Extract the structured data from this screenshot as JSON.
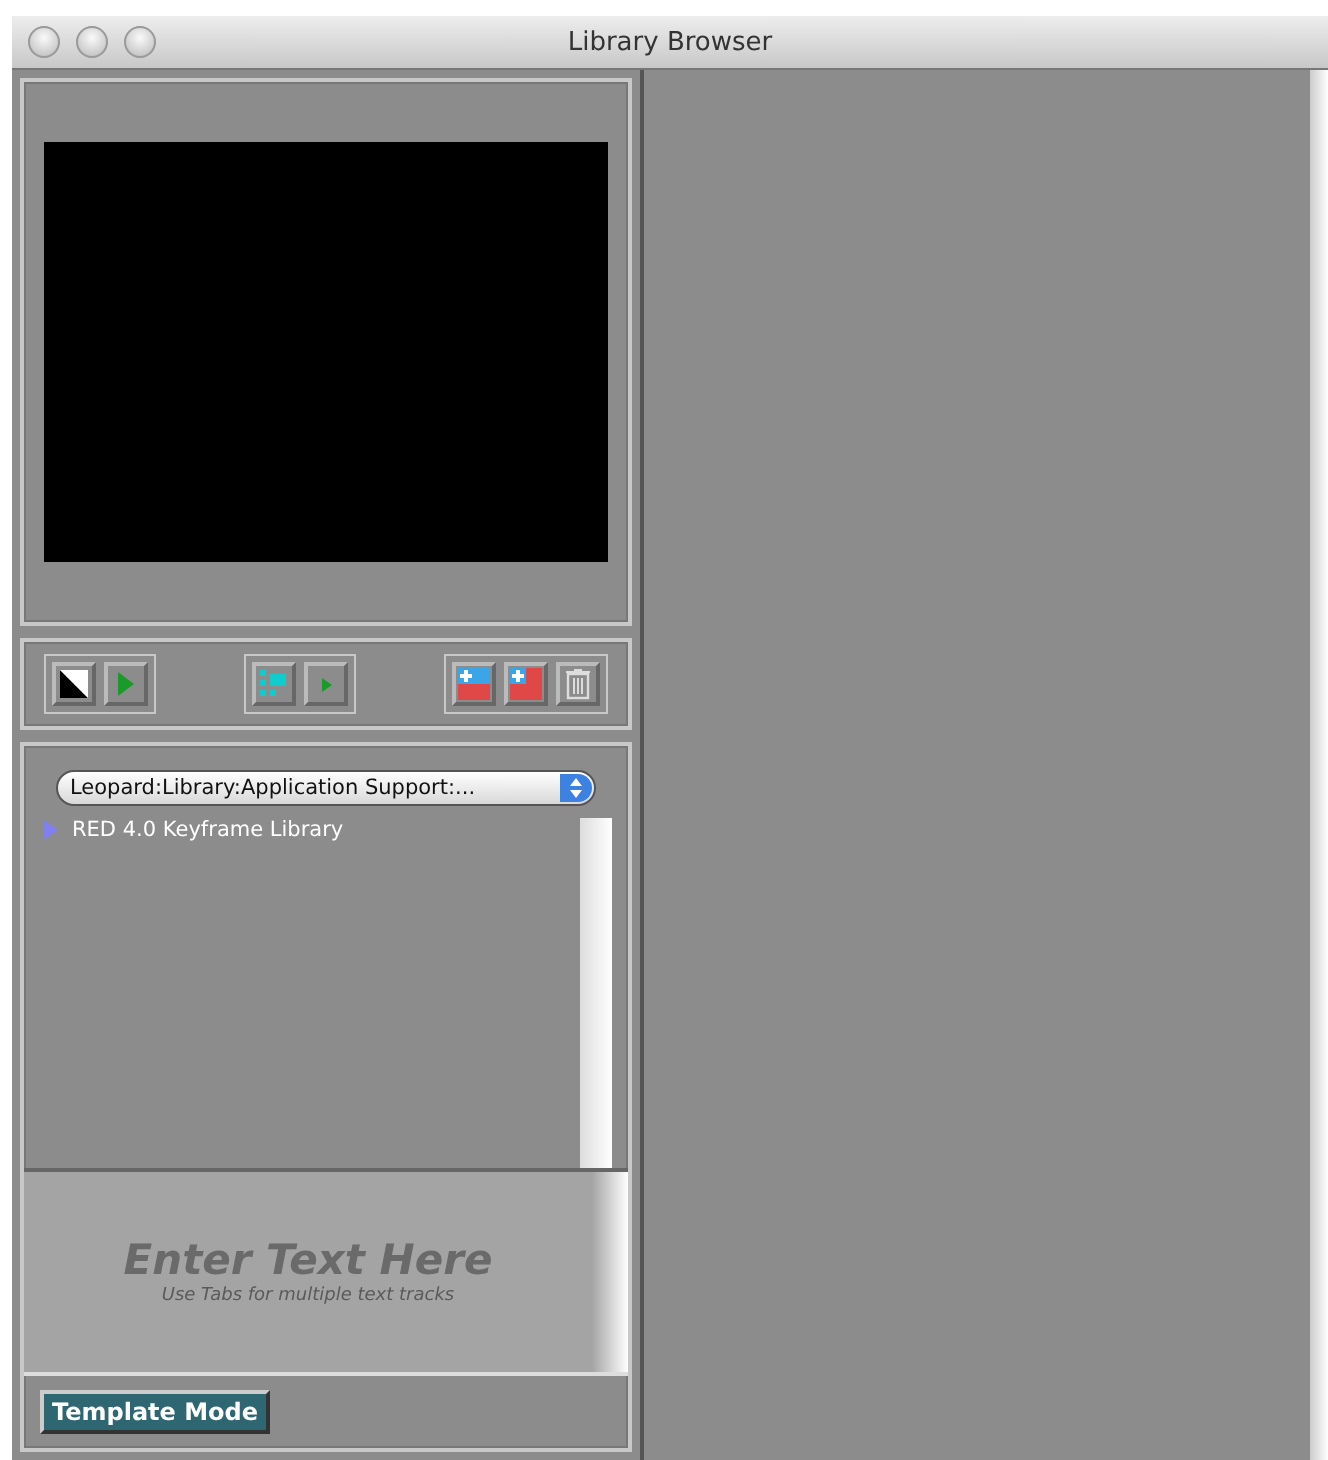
{
  "window": {
    "title": "Library Browser"
  },
  "toolbar": {
    "groups": [
      [
        {
          "kind": "black-white"
        },
        {
          "kind": "play"
        }
      ],
      [
        {
          "kind": "grid"
        },
        {
          "kind": "play-small"
        }
      ],
      [
        {
          "kind": "add-blue"
        },
        {
          "kind": "add-red"
        },
        {
          "kind": "trash"
        }
      ]
    ]
  },
  "path_popup": {
    "value": "Leopard:Library:Application Support:..."
  },
  "tree": [
    {
      "label": "RED 4.0 Keyframe Library",
      "expanded": false
    }
  ],
  "text_entry": {
    "placeholder": "Enter Text Here",
    "hint": "Use Tabs for multiple text tracks"
  },
  "template_button": {
    "label": "Template Mode"
  }
}
